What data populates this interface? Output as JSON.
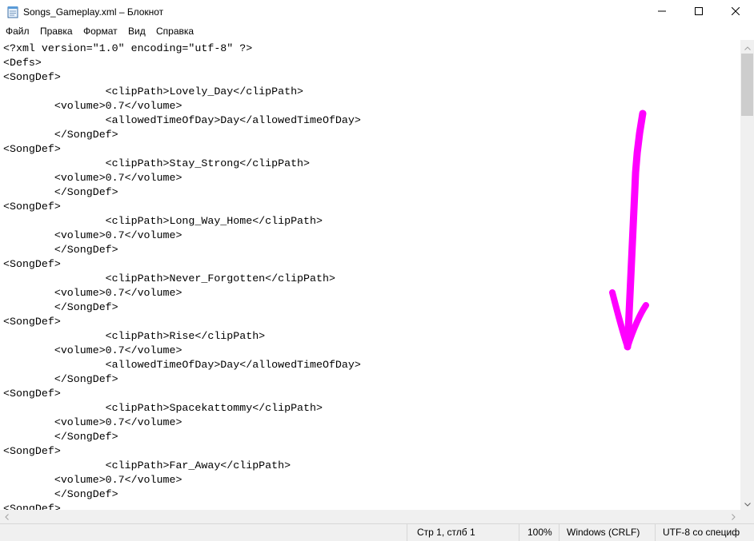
{
  "window": {
    "title": "Songs_Gameplay.xml – Блокнот",
    "minimize_icon": "minimize-icon",
    "maximize_icon": "maximize-icon",
    "close_icon": "close-icon"
  },
  "menu": {
    "items": [
      "Файл",
      "Правка",
      "Формат",
      "Вид",
      "Справка"
    ]
  },
  "editor": {
    "lines": [
      "<?xml version=\"1.0\" encoding=\"utf-8\" ?>",
      "<Defs>",
      "<SongDef>",
      "\t\t<clipPath>Lovely_Day</clipPath>",
      "\t<volume>0.7</volume>",
      "\t\t<allowedTimeOfDay>Day</allowedTimeOfDay>",
      "\t</SongDef>",
      "<SongDef>",
      "\t\t<clipPath>Stay_Strong</clipPath>",
      "\t<volume>0.7</volume>",
      "\t</SongDef>",
      "<SongDef>",
      "\t\t<clipPath>Long_Way_Home</clipPath>",
      "\t<volume>0.7</volume>",
      "\t</SongDef>",
      "<SongDef>",
      "\t\t<clipPath>Never_Forgotten</clipPath>",
      "\t<volume>0.7</volume>",
      "\t</SongDef>",
      "<SongDef>",
      "\t\t<clipPath>Rise</clipPath>",
      "\t<volume>0.7</volume>",
      "\t\t<allowedTimeOfDay>Day</allowedTimeOfDay>",
      "\t</SongDef>",
      "<SongDef>",
      "\t\t<clipPath>Spacekattommy</clipPath>",
      "\t<volume>0.7</volume>",
      "\t</SongDef>",
      "<SongDef>",
      "\t\t<clipPath>Far_Away</clipPath>",
      "\t<volume>0.7</volume>",
      "\t</SongDef>",
      "<SongDef>"
    ]
  },
  "status": {
    "position": "Стр 1, стлб 1",
    "zoom": "100%",
    "line_endings": "Windows (CRLF)",
    "encoding": "UTF-8 со специф"
  },
  "annotation": {
    "color": "#ff00ff",
    "icon": "down-arrow-annotation"
  }
}
